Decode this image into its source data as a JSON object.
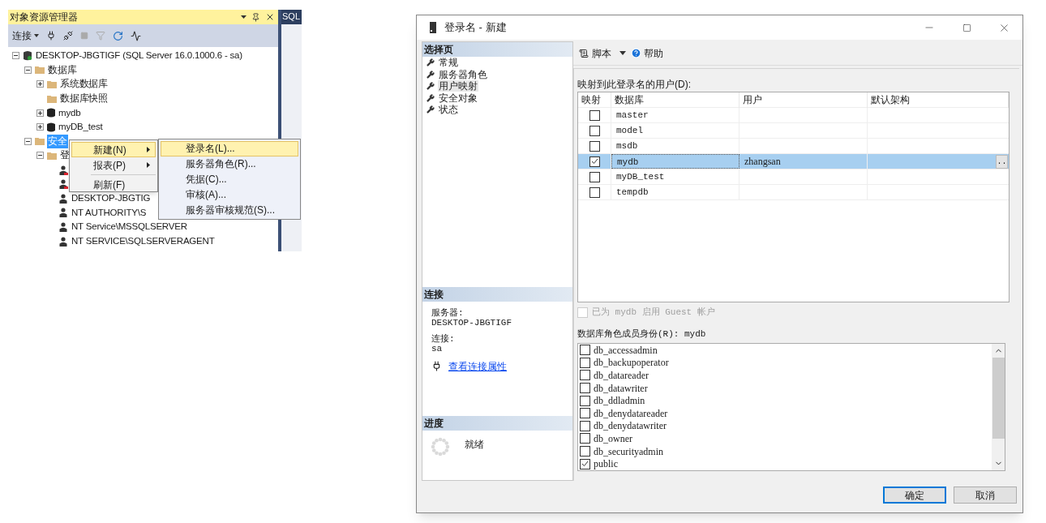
{
  "object_explorer": {
    "title": "对象资源管理器",
    "connect_label": "连接",
    "editor_tab": "SQL",
    "tree": [
      {
        "kind": "server",
        "label": "DESKTOP-JBGTIGF (SQL Server 16.0.1000.6 - sa)",
        "expanded": true,
        "selected": false,
        "children": [
          {
            "kind": "folder",
            "label": "数据库",
            "expanded": true,
            "selected": false,
            "children": [
              {
                "kind": "folder",
                "label": "系统数据库",
                "expanded": false,
                "selected": false
              },
              {
                "kind": "folder",
                "label": "数据库快照",
                "selected": false
              },
              {
                "kind": "database",
                "label": "mydb",
                "expanded": false,
                "selected": false
              },
              {
                "kind": "database",
                "label": "myDB_test",
                "expanded": false,
                "selected": false
              }
            ]
          },
          {
            "kind": "folder",
            "label": "安全",
            "expanded": true,
            "selected": true,
            "children": [
              {
                "kind": "folder",
                "label": "登",
                "expanded": true,
                "selected": false,
                "children": [
                  {
                    "kind": "login",
                    "disabled": true,
                    "selected": false
                  },
                  {
                    "kind": "login",
                    "disabled": true,
                    "selected": false
                  },
                  {
                    "kind": "login",
                    "label": "DESKTOP-JBGTIG",
                    "disabled": false,
                    "selected": false
                  },
                  {
                    "kind": "login",
                    "label": "NT AUTHORITY\\S",
                    "disabled": false,
                    "selected": false
                  },
                  {
                    "kind": "login",
                    "label": "NT Service\\MSSQLSERVER",
                    "disabled": false,
                    "selected": false
                  },
                  {
                    "kind": "login",
                    "label": "NT SERVICE\\SQLSERVERAGENT",
                    "disabled": false,
                    "selected": false
                  }
                ]
              }
            ]
          }
        ]
      }
    ],
    "context_menu": [
      {
        "kind": "submenu",
        "label": "新建(N)",
        "selected": true
      },
      {
        "kind": "submenu",
        "label": "报表(P)",
        "selected": false
      },
      {
        "kind": "separator"
      },
      {
        "kind": "item",
        "label": "刷新(F)",
        "selected": false
      }
    ],
    "submenu": [
      {
        "label": "登录名(L)...",
        "selected": true
      },
      {
        "label": "服务器角色(R)...",
        "selected": false
      },
      {
        "label": "凭据(C)...",
        "selected": false
      },
      {
        "label": "审核(A)...",
        "selected": false
      },
      {
        "label": "服务器审核规范(S)...",
        "selected": false
      }
    ]
  },
  "dialog": {
    "title": "登录名 - 新建",
    "pages_header": "选择页",
    "pages": [
      {
        "label": "常规",
        "selected": false
      },
      {
        "label": "服务器角色",
        "selected": false
      },
      {
        "label": "用户映射",
        "selected": true
      },
      {
        "label": "安全对象",
        "selected": false
      },
      {
        "label": "状态",
        "selected": false
      }
    ],
    "connection": {
      "header": "连接",
      "server_label": "服务器:",
      "server": "DESKTOP-JBGTIGF",
      "connection_label": "连接:",
      "connection": "sa",
      "link": "查看连接属性"
    },
    "progress": {
      "header": "进度",
      "status": "就绪"
    },
    "toolbar": {
      "script": "脚本",
      "help": "帮助"
    },
    "mapping_label": "映射到此登录名的用户(D):",
    "mapping_columns": [
      "映射",
      "数据库",
      "用户",
      "默认架构"
    ],
    "browse_button": "..",
    "mappings": [
      {
        "mapped": false,
        "database": "master",
        "selected": false
      },
      {
        "mapped": false,
        "database": "model",
        "selected": false
      },
      {
        "mapped": false,
        "database": "msdb",
        "selected": false
      },
      {
        "mapped": true,
        "database": "mydb",
        "user": "zhangsan",
        "selected": true
      },
      {
        "mapped": false,
        "database": "myDB_test",
        "selected": false
      },
      {
        "mapped": false,
        "database": "tempdb",
        "selected": false
      }
    ],
    "guest": {
      "label": "已为 mydb 启用 Guest 帐户",
      "checked": false,
      "disabled": true
    },
    "roles_label": "数据库角色成员身份(R): mydb",
    "roles": [
      {
        "name": "db_accessadmin",
        "checked": false
      },
      {
        "name": "db_backupoperator",
        "checked": false
      },
      {
        "name": "db_datareader",
        "checked": false
      },
      {
        "name": "db_datawriter",
        "checked": false
      },
      {
        "name": "db_ddladmin",
        "checked": false
      },
      {
        "name": "db_denydatareader",
        "checked": false
      },
      {
        "name": "db_denydatawriter",
        "checked": false
      },
      {
        "name": "db_owner",
        "checked": false
      },
      {
        "name": "db_securityadmin",
        "checked": false
      },
      {
        "name": "public",
        "checked": true
      }
    ],
    "buttons": [
      {
        "label": "确定",
        "default": true
      },
      {
        "label": "取消",
        "default": false
      }
    ]
  }
}
